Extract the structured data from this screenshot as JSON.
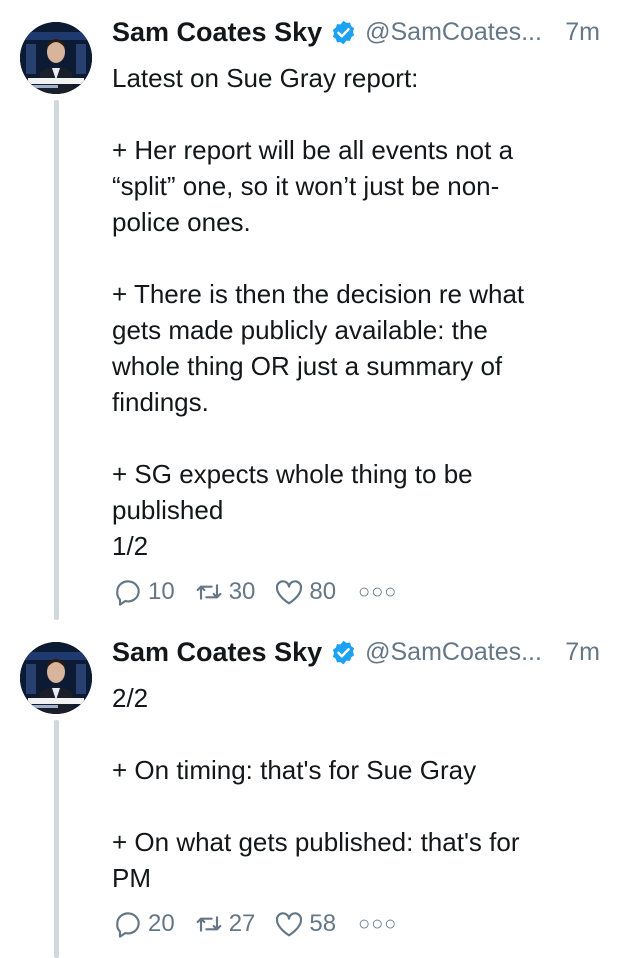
{
  "tweets": [
    {
      "author": "Sam Coates Sky",
      "handle": "@SamCoates...",
      "time": "7m",
      "lines": [
        "Latest on Sue Gray report:",
        "",
        "+ Her report will be all events not a",
        "“split” one, so it won’t just be non-",
        "police ones.",
        "",
        "+ There is then the decision re what",
        "gets made publicly available: the",
        "whole thing OR just a summary of",
        "findings.",
        "",
        "+ SG expects whole thing to be",
        "published",
        "1/2"
      ],
      "replies": "10",
      "retweets": "30",
      "likes": "80"
    },
    {
      "author": "Sam Coates Sky",
      "handle": "@SamCoates...",
      "time": "7m",
      "lines": [
        "2/2",
        "",
        "+ On timing: that's for Sue Gray",
        "",
        "+ On what gets published: that's for",
        "PM"
      ],
      "replies": "20",
      "retweets": "27",
      "likes": "58"
    }
  ],
  "colors": {
    "text": "#14171a",
    "secondary": "#657786",
    "verified": "#1da1f2",
    "thread": "#cfd9de"
  },
  "icons": {
    "reply": "reply-icon",
    "retweet": "retweet-icon",
    "like": "heart-icon",
    "more": "more-icon"
  }
}
